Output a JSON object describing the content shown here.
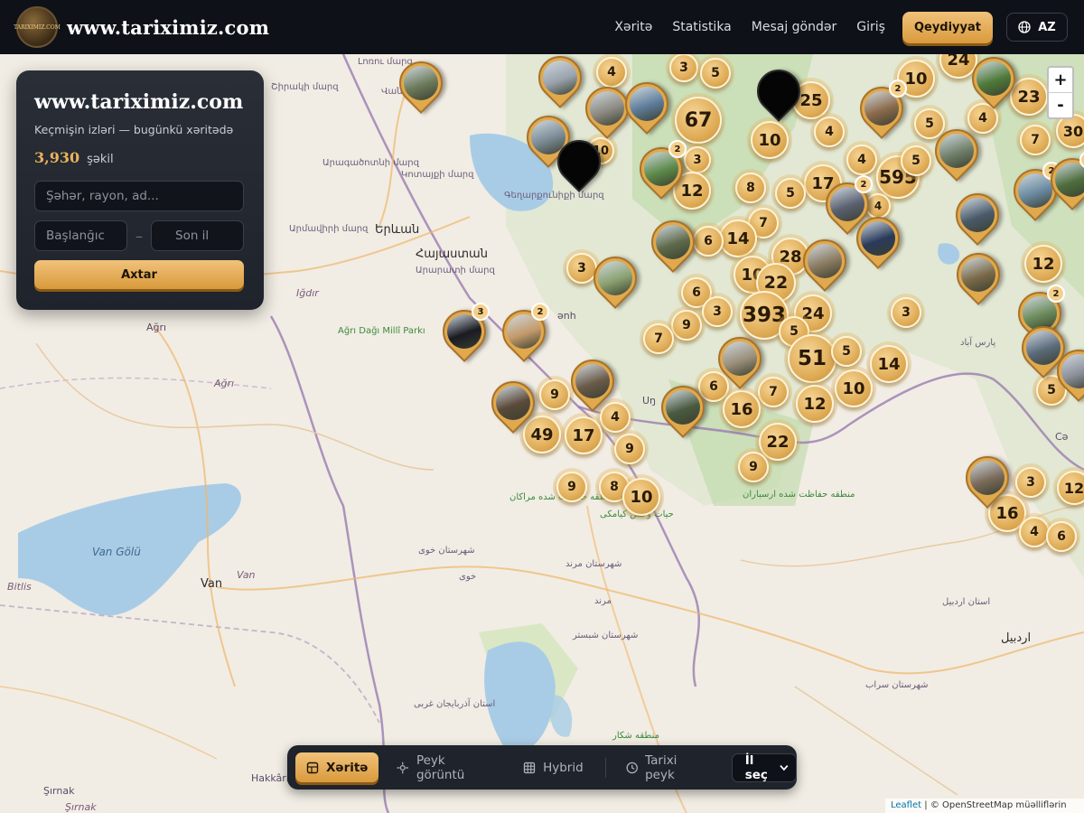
{
  "header": {
    "brand_title": "www.tariximiz.com",
    "logo_text": "TARIXIMIZ.COM",
    "nav": [
      "Xəritə",
      "Statistika",
      "Mesaj göndər",
      "Giriş"
    ],
    "register_label": "Qeydiyyat",
    "language": "AZ"
  },
  "panel": {
    "title": "www.tariximiz.com",
    "subtitle": "Keçmişin izləri — bugünkü xəritədə",
    "photo_count": "3,930",
    "photo_count_label": "şəkil",
    "search_placeholder": "Şəhər, rayon, ad...",
    "start_placeholder": "Başlanğıc",
    "end_placeholder": "Son il",
    "separator": "–",
    "search_button": "Axtar"
  },
  "zoom": {
    "in": "+",
    "out": "-"
  },
  "bottom_bar": {
    "modes": [
      "Xəritə",
      "Peyk görüntü",
      "Hybrid",
      "Tarixi peyk"
    ],
    "active_mode": "Xəritə",
    "year_select": "İl seç"
  },
  "attribution": {
    "leaflet": "Leaflet",
    "sep": "|",
    "osm": "© OpenStreetMap müəlliflərin"
  },
  "map_labels": [
    {
      "text": "Երևան",
      "cls": "big"
    },
    {
      "text": "Հայաստան",
      "cls": "big"
    },
    {
      "text": "Iğdır",
      "cls": "it"
    },
    {
      "text": "Ağrı",
      "cls": ""
    },
    {
      "text": "Ağrı",
      "cls": "it"
    },
    {
      "text": "Ağrı Dağı Millî Parkı",
      "cls": "green"
    },
    {
      "text": "Van Gölü",
      "cls": "water"
    },
    {
      "text": "Van",
      "cls": "it"
    },
    {
      "text": "Van",
      "cls": "big"
    },
    {
      "text": "Bitlis",
      "cls": "it"
    },
    {
      "text": "Hakkâri",
      "cls": ""
    },
    {
      "text": "Şırnak",
      "cls": ""
    },
    {
      "text": "Şırnak",
      "cls": "it"
    },
    {
      "text": "Արագածոտնի մարզ",
      "cls": "fa"
    },
    {
      "text": "Կոտայքի մարզ",
      "cls": "fa"
    },
    {
      "text": "Արմավիրի մարզ",
      "cls": "fa"
    },
    {
      "text": "Արարատի մարզ",
      "cls": "fa"
    },
    {
      "text": "Գեղարքունիքի մարզ",
      "cls": "fa"
    },
    {
      "text": "Շիրակի մարզ",
      "cls": "fa"
    },
    {
      "text": "Լոռու մարզ",
      "cls": "fa"
    },
    {
      "text": "Վանաձոր",
      "cls": "fa"
    },
    {
      "text": "پارس آباد",
      "cls": "fa"
    },
    {
      "text": "استان اردبیل",
      "cls": "fa"
    },
    {
      "text": "اردبیل",
      "cls": "big"
    },
    {
      "text": "شهرستان خوی",
      "cls": "fa"
    },
    {
      "text": "خوی",
      "cls": "fa"
    },
    {
      "text": "شهرستان مرند",
      "cls": "fa"
    },
    {
      "text": "مرند",
      "cls": "fa"
    },
    {
      "text": "شهرستان شبستر",
      "cls": "fa"
    },
    {
      "text": "استان آذربایجان غربی",
      "cls": "fa"
    },
    {
      "text": "شهرستان سراب",
      "cls": "fa"
    },
    {
      "text": "منطقه حفاظت شده مراکان",
      "cls": "green"
    },
    {
      "text": "حیات وحش کیامکی",
      "cls": "green"
    },
    {
      "text": "منطقه حفاظت شده ارسباران",
      "cls": "green"
    },
    {
      "text": "منطقه شکار",
      "cls": "green"
    },
    {
      "text": "Cə",
      "cls": ""
    },
    {
      "text": "Uŋ",
      "cls": ""
    },
    {
      "text": "ənh",
      "cls": ""
    }
  ],
  "clusters": [
    "4",
    "3",
    "5",
    "24",
    "10",
    "25",
    "67",
    "10",
    "4",
    "23",
    "4",
    "5",
    "7",
    "30",
    "4",
    "3",
    "12",
    "17",
    "595",
    "4",
    "5",
    "8",
    "5",
    "7",
    "14",
    "6",
    "28",
    "12",
    "10",
    "22",
    "3",
    "6",
    "3",
    "393",
    "24",
    "9",
    "7",
    "5",
    "51",
    "5",
    "14",
    "6",
    "7",
    "16",
    "12",
    "10",
    "9",
    "4",
    "49",
    "17",
    "9",
    "22",
    "9",
    "9",
    "8",
    "10",
    "3",
    "16",
    "4",
    "6",
    "3",
    "5",
    "12",
    "10"
  ],
  "photo_pins": [
    {
      "badge": "",
      "photo_color": "#6c7a5a"
    },
    {
      "badge": "",
      "photo_color": "#9aa3ad"
    },
    {
      "badge": "",
      "photo_color": "#8c8a82"
    },
    {
      "badge": "",
      "photo_color": "#5d7c9a"
    },
    {
      "badge": "",
      "photo_color": "#7a8a94"
    },
    {
      "badge": "",
      "photo_color": "#000000"
    },
    {
      "badge": "",
      "photo_color": "#000000"
    },
    {
      "badge": "2",
      "photo_color": "#5d8a4a"
    },
    {
      "badge": "2",
      "photo_color": "#8a6a4a"
    },
    {
      "badge": "",
      "photo_color": "#4f7a3a"
    },
    {
      "badge": "2",
      "photo_color": "#5a6070"
    },
    {
      "badge": "",
      "photo_color": "#6f7f6a"
    },
    {
      "badge": "2",
      "photo_color": "#6a8aa0"
    },
    {
      "badge": "2",
      "photo_color": "#4e6e3e"
    },
    {
      "badge": "",
      "photo_color": "#5e6a4a"
    },
    {
      "badge": "",
      "photo_color": "#4a5a6a"
    },
    {
      "badge": "",
      "photo_color": "#2a3a5a"
    },
    {
      "badge": "",
      "photo_color": "#8a7a60"
    },
    {
      "badge": "3",
      "photo_color": "#1a1a22"
    },
    {
      "badge": "2",
      "photo_color": "#c29a6a"
    },
    {
      "badge": "",
      "photo_color": "#8aa070"
    },
    {
      "badge": "",
      "photo_color": "#7a6a48"
    },
    {
      "badge": "",
      "photo_color": "#6a5a48"
    },
    {
      "badge": "",
      "photo_color": "#9a8f7a"
    },
    {
      "badge": "",
      "photo_color": "#4a5a40"
    },
    {
      "badge": "",
      "photo_color": "#5a4a3a"
    },
    {
      "badge": "2",
      "photo_color": "#6a8a5a"
    },
    {
      "badge": "",
      "photo_color": "#5a6a7a"
    },
    {
      "badge": "",
      "photo_color": "#8a8f9a"
    },
    {
      "badge": "",
      "photo_color": "#7a6a5a"
    }
  ]
}
